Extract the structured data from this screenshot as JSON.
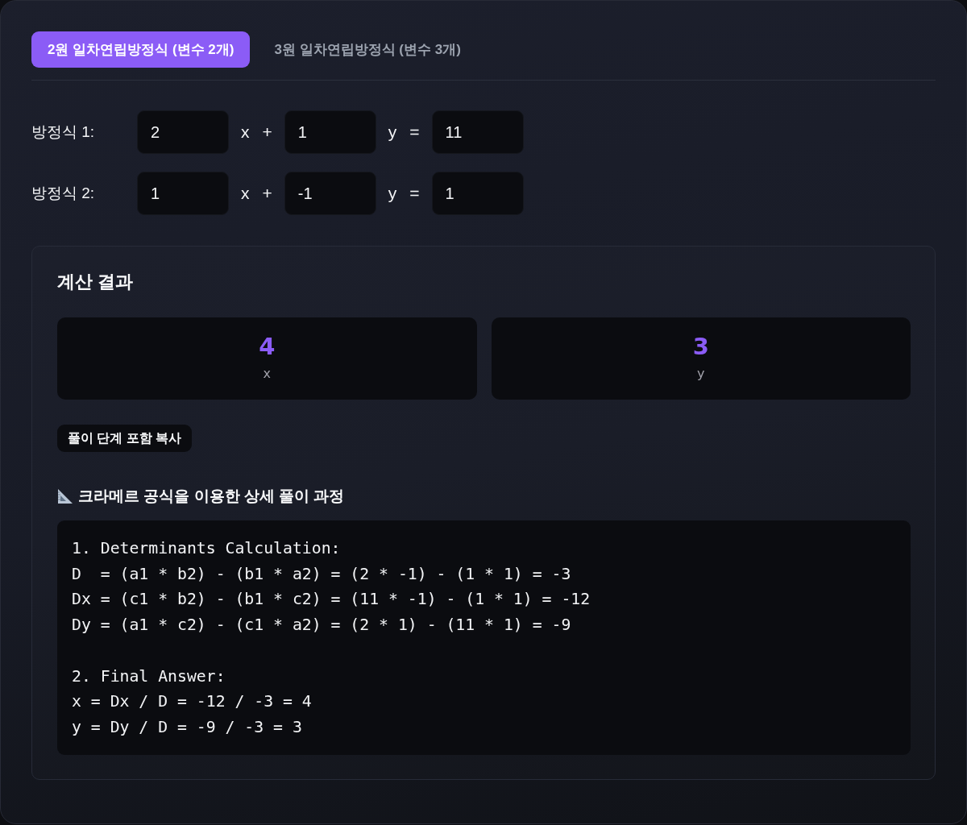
{
  "tabs": [
    {
      "label": "2원 일차연립방정식 (변수 2개)",
      "selected": true
    },
    {
      "label": "3원 일차연립방정식 (변수 3개)",
      "selected": false
    }
  ],
  "equations": [
    {
      "label": "방정식 1:",
      "parts": [
        {
          "kind": "input",
          "value": "2"
        },
        {
          "kind": "variable",
          "text": "x"
        },
        {
          "kind": "operator",
          "text": "+"
        },
        {
          "kind": "input",
          "value": "1"
        },
        {
          "kind": "variable",
          "text": "y"
        },
        {
          "kind": "operator",
          "text": "="
        },
        {
          "kind": "input",
          "value": "11"
        }
      ]
    },
    {
      "label": "방정식 2:",
      "parts": [
        {
          "kind": "input",
          "value": "1"
        },
        {
          "kind": "variable",
          "text": "x"
        },
        {
          "kind": "operator",
          "text": "+"
        },
        {
          "kind": "input",
          "value": "-1"
        },
        {
          "kind": "variable",
          "text": "y"
        },
        {
          "kind": "operator",
          "text": "="
        },
        {
          "kind": "input",
          "value": "1"
        }
      ]
    }
  ],
  "results_panel": {
    "title": "계산 결과",
    "results": [
      {
        "value": "4",
        "label": "x"
      },
      {
        "value": "3",
        "label": "y"
      }
    ],
    "copy_button": "풀이 단계 포함 복사",
    "solution_heading": "크라메르 공식을 이용한 상세 풀이 과정",
    "solution_sections": [
      {
        "title": "1. Determinants Calculation:",
        "lines": [
          "D  = (a1 * b2) - (b1 * a2) = (2 * -1) - (1 * 1) = -3",
          "Dx = (c1 * b2) - (b1 * c2) = (11 * -1) - (1 * 1) = -12",
          "Dy = (a1 * c2) - (c1 * a2) = (2 * 1) - (11 * 1) = -9"
        ]
      },
      {
        "title": "2. Final Answer:",
        "lines": [
          "x = Dx / D = -12 / -3 = 4",
          "y = Dy / D = -9 / -3 = 3"
        ]
      }
    ]
  }
}
